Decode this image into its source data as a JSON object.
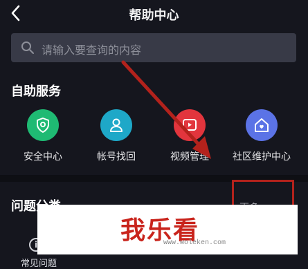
{
  "header": {
    "title": "帮助中心"
  },
  "search": {
    "placeholder": "请输入要查询的内容"
  },
  "self_service": {
    "title": "自助服务",
    "items": [
      {
        "label": "安全中心",
        "icon": "shield-icon",
        "color": "#1fba73"
      },
      {
        "label": "帐号找回",
        "icon": "user-icon",
        "color": "#1ea8c8"
      },
      {
        "label": "视频管理",
        "icon": "video-icon",
        "color": "#e2353d"
      },
      {
        "label": "社区维护中心",
        "icon": "home-icon",
        "color": "#5b73e6"
      }
    ]
  },
  "questions": {
    "title": "问题分类",
    "more_label": "更多 ›",
    "items": [
      {
        "label": "常见问题",
        "icon": "info-icon"
      }
    ]
  },
  "watermark": {
    "brand": "我乐看",
    "url": "www.woleken.com"
  },
  "colors": {
    "background": "#15161e",
    "annotation": "#b3221c"
  }
}
